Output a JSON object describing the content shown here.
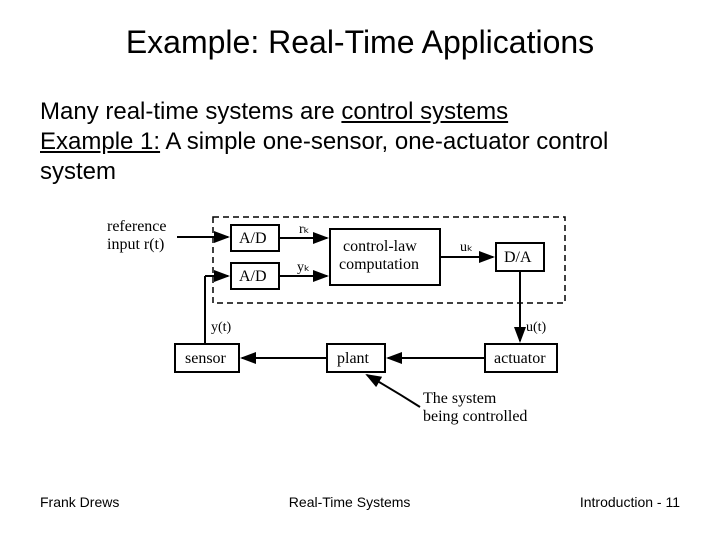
{
  "title": "Example: Real-Time Applications",
  "body": {
    "line1_pre": "Many real-time systems are ",
    "line1_underlined": "control systems",
    "line2_label": "Example 1:",
    "line2_rest": " A simple one-sensor, one-actuator control system"
  },
  "diagram": {
    "reference_label_1": "reference",
    "reference_label_2": "input r(t)",
    "ad1": "A/D",
    "ad2": "A/D",
    "rk": "rₖ",
    "yk": "yₖ",
    "block_cl_1": "control-law",
    "block_cl_2": "computation",
    "uk": "uₖ",
    "da": "D/A",
    "yt": "y(t)",
    "ut": "u(t)",
    "sensor": "sensor",
    "plant": "plant",
    "actuator": "actuator",
    "note_1": "The system",
    "note_2": "being controlled"
  },
  "footer": {
    "left": "Frank Drews",
    "center": "Real-Time Systems",
    "right": "Introduction - 11"
  }
}
